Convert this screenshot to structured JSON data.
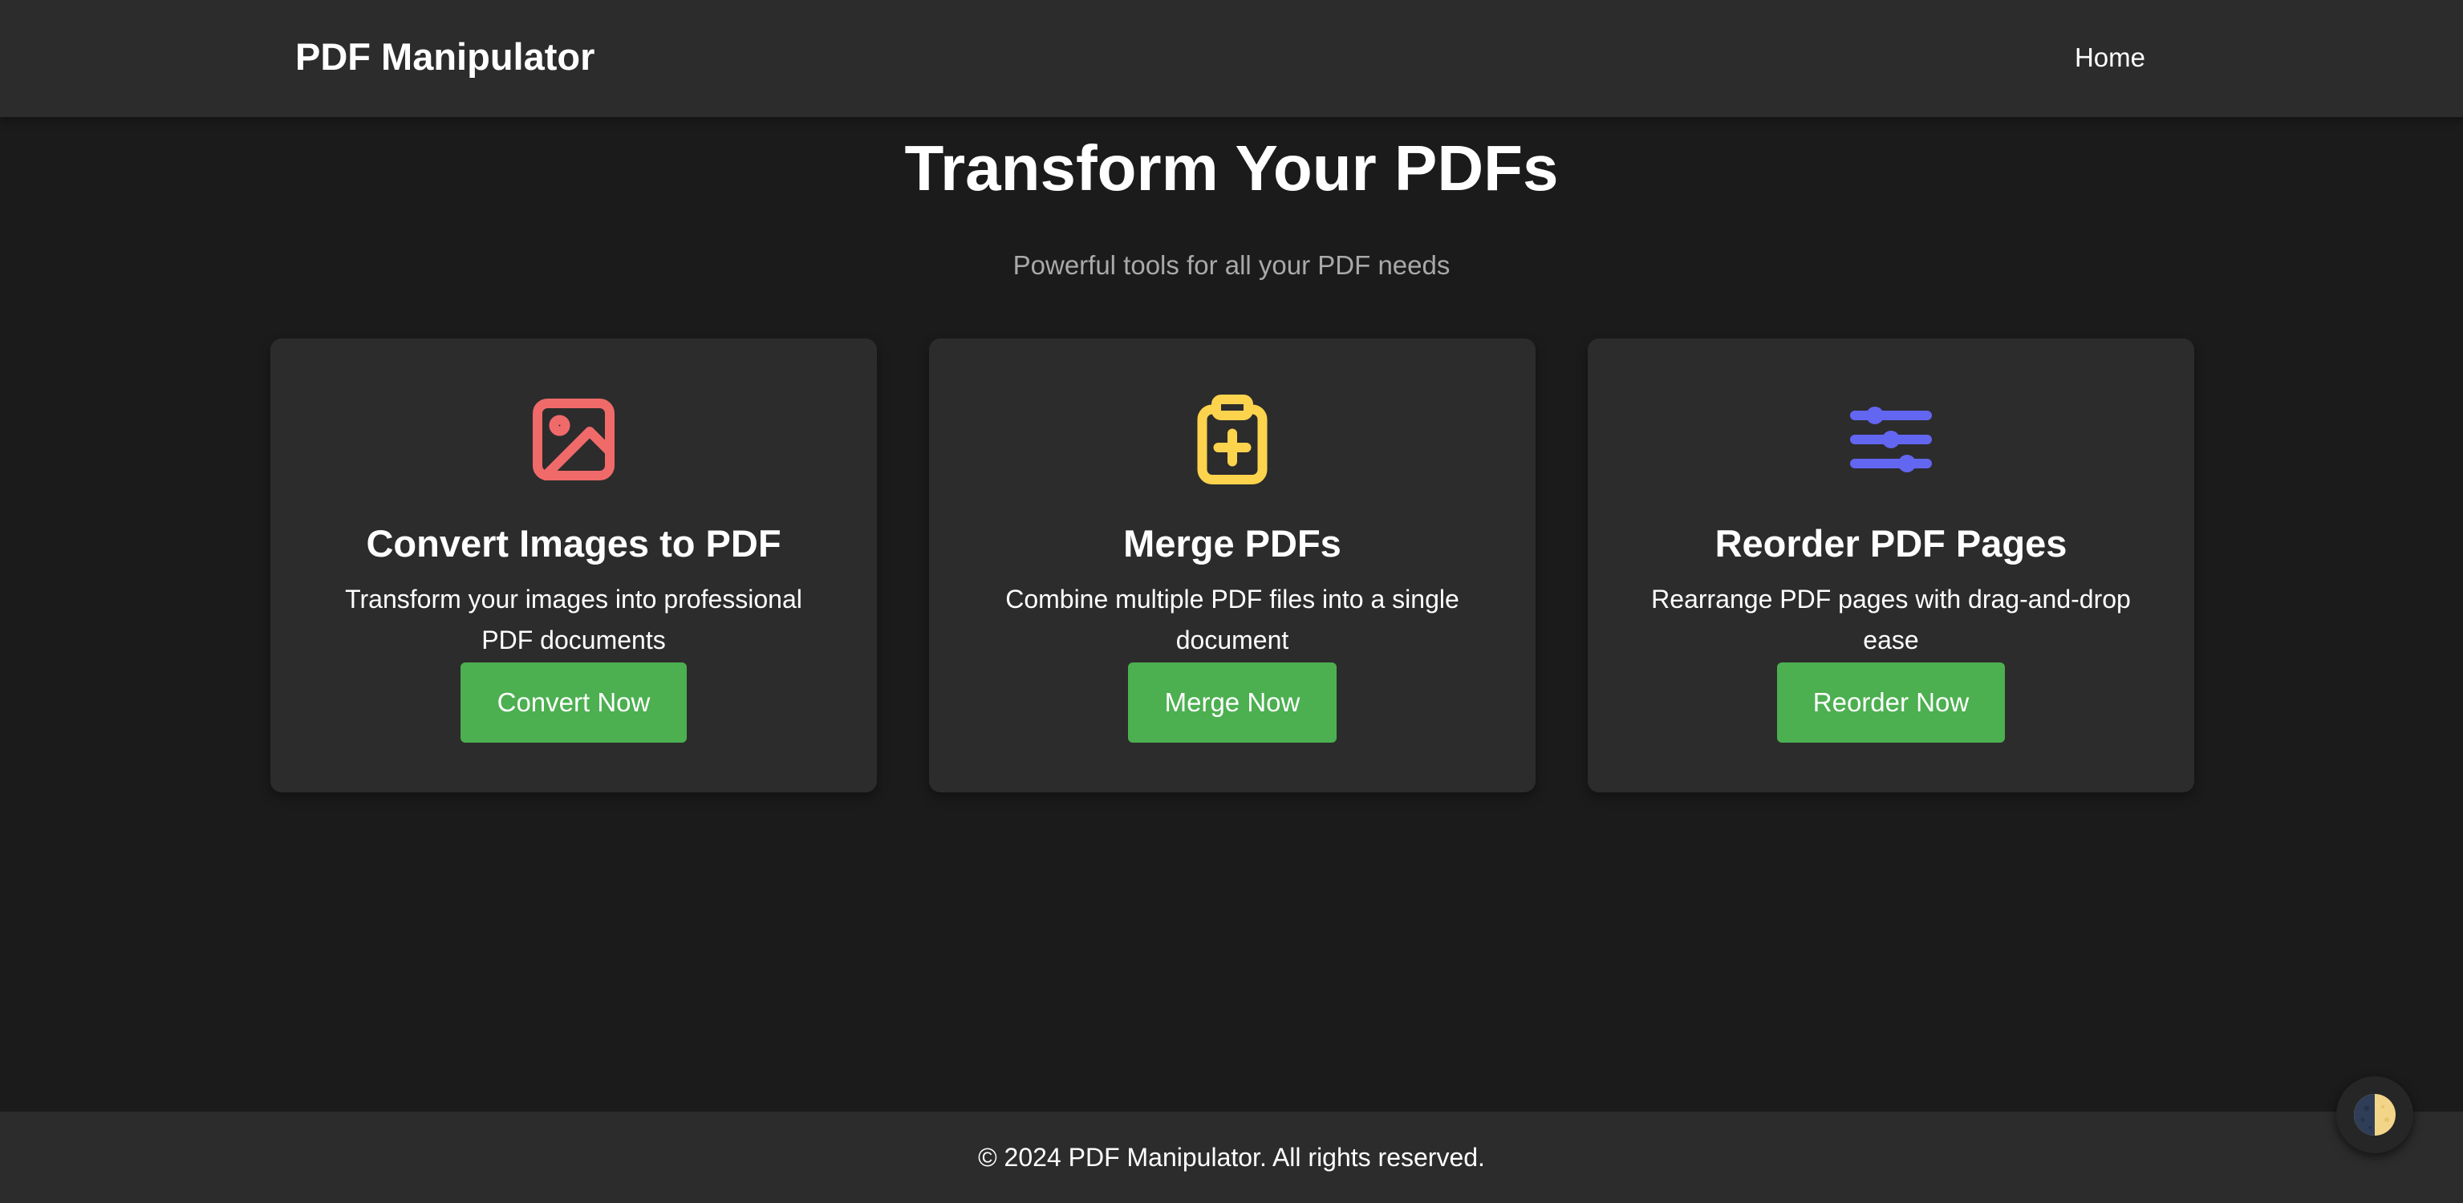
{
  "header": {
    "brand": "PDF Manipulator",
    "nav": {
      "home_label": "Home"
    }
  },
  "hero": {
    "title": "Transform Your PDFs",
    "subtitle": "Powerful tools for all your PDF needs"
  },
  "cards": [
    {
      "icon": "image-icon",
      "icon_color": "#f06a6a",
      "title": "Convert Images to PDF",
      "description": "Transform your images into professional PDF documents",
      "button_label": "Convert Now"
    },
    {
      "icon": "clipboard-plus-icon",
      "icon_color": "#fcd34d",
      "title": "Merge PDFs",
      "description": "Combine multiple PDF files into a single document",
      "button_label": "Merge Now"
    },
    {
      "icon": "sliders-icon",
      "icon_color": "#6366f1",
      "title": "Reorder PDF Pages",
      "description": "Rearrange PDF pages with drag-and-drop ease",
      "button_label": "Reorder Now"
    }
  ],
  "footer": {
    "text": "© 2024 PDF Manipulator. All rights reserved."
  },
  "theme_toggle": {
    "icon": "half-moon-icon"
  },
  "colors": {
    "background": "#1b1b1b",
    "surface": "#2c2c2c",
    "button": "#4caf50",
    "subtitle": "#a9a9a9"
  }
}
